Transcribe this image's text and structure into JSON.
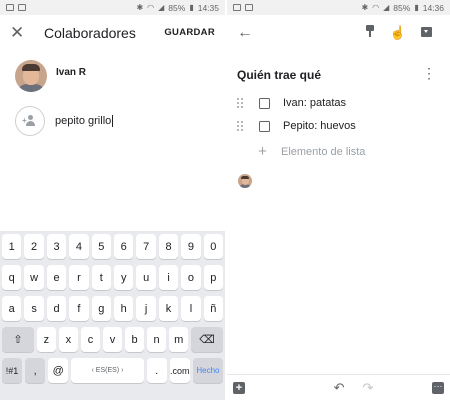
{
  "left_status": {
    "battery": "85%",
    "time": "14:35"
  },
  "right_status": {
    "battery": "85%",
    "time": "14:36"
  },
  "collab": {
    "close_icon": "close-icon",
    "title": "Colaboradores",
    "save_label": "GUARDAR",
    "owner_name": "Ivan R",
    "input_value": "pepito grillo"
  },
  "keyboard": {
    "row1": [
      "1",
      "2",
      "3",
      "4",
      "5",
      "6",
      "7",
      "8",
      "9",
      "0"
    ],
    "row2": [
      "q",
      "w",
      "e",
      "r",
      "t",
      "y",
      "u",
      "i",
      "o",
      "p"
    ],
    "row3": [
      "a",
      "s",
      "d",
      "f",
      "g",
      "h",
      "j",
      "k",
      "l",
      "ñ"
    ],
    "row4": [
      "z",
      "x",
      "c",
      "v",
      "b",
      "n",
      "m"
    ],
    "sym_label": "!#1",
    "comma": ",",
    "at": "@",
    "space_label": "ES(ES)",
    "dot": ".",
    "com": ".com",
    "enter_label": "Hecho",
    "shift_icon": "shift-icon",
    "backspace_icon": "backspace-icon"
  },
  "note": {
    "title": "Quién trae qué",
    "items": [
      {
        "text": "Ivan: patatas",
        "checked": false
      },
      {
        "text": "Pepito: huevos",
        "checked": false
      }
    ],
    "add_item_placeholder": "Elemento de lista",
    "toolbar_icons": [
      "pin-icon",
      "reminder-icon",
      "archive-icon"
    ],
    "bottom_icons": [
      "add-box-icon",
      "undo-icon",
      "redo-icon",
      "more-icon"
    ]
  },
  "colors": {
    "accent": "#4285f4",
    "keyboard_bg": "#e9eaed",
    "statusbar_bg": "#f1f1f1"
  }
}
